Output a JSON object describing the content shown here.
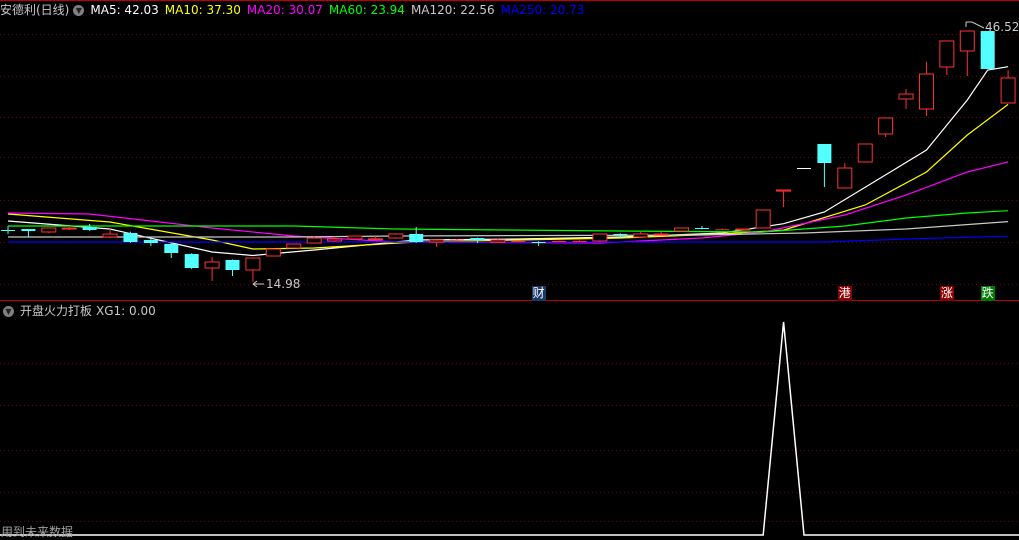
{
  "header": {
    "stock_title": "安德利(日线)",
    "ma": [
      {
        "label": "MA5: 42.03",
        "color": "#ffffff"
      },
      {
        "label": "MA10: 37.30",
        "color": "#ffff00"
      },
      {
        "label": "MA20: 30.07",
        "color": "#ff00ff"
      },
      {
        "label": "MA60: 23.94",
        "color": "#00ff00"
      },
      {
        "label": "MA120: 22.56",
        "color": "#c8c8c8"
      },
      {
        "label": "MA250: 20.73",
        "color": "#0000ff"
      }
    ]
  },
  "indicator": {
    "title": "开盘火力打板",
    "value_label": "XG1: 0.00"
  },
  "footer_note": "用到未来数据",
  "annotations": {
    "high": "46.52",
    "low": "14.98"
  },
  "markers": [
    {
      "text": "财",
      "index": 26,
      "bg": "#1a3a6a"
    },
    {
      "text": "港",
      "index": 41,
      "bg": "#8b0000"
    },
    {
      "text": "涨",
      "index": 46,
      "bg": "#8b0000"
    },
    {
      "text": "跌",
      "index": 48,
      "bg": "#007a00"
    }
  ],
  "colors": {
    "up": "#ff3232",
    "down": "#54ffff",
    "flat": "#ffffff",
    "grid": "#7a0000",
    "divider": "#c00000"
  },
  "chart_data": {
    "type": "candlestick",
    "price_range": [
      14.98,
      46.52
    ],
    "ohlc": [
      [
        21.51,
        22.01,
        21.01,
        21.48
      ],
      [
        21.63,
        21.63,
        20.63,
        21.38
      ],
      [
        21.26,
        21.76,
        21.13,
        21.76
      ],
      [
        21.63,
        21.89,
        21.5,
        21.76
      ],
      [
        21.89,
        22.26,
        21.4,
        21.51
      ],
      [
        20.63,
        21.76,
        20.5,
        21.0
      ],
      [
        21.13,
        21.3,
        19.9,
        20.0
      ],
      [
        20.25,
        20.6,
        19.5,
        19.87
      ],
      [
        19.75,
        19.9,
        17.99,
        18.62
      ],
      [
        18.49,
        18.6,
        16.6,
        16.73
      ],
      [
        16.73,
        18.11,
        15.1,
        17.49
      ],
      [
        17.74,
        17.8,
        15.73,
        16.48
      ],
      [
        16.48,
        17.99,
        14.98,
        17.99
      ],
      [
        18.24,
        19.2,
        18.2,
        19.12
      ],
      [
        19.25,
        19.8,
        19.2,
        19.75
      ],
      [
        19.87,
        20.75,
        19.8,
        20.5
      ],
      [
        20.13,
        20.7,
        20.0,
        20.38
      ],
      [
        20.38,
        20.8,
        20.3,
        20.75
      ],
      [
        20.38,
        20.75,
        20.3,
        20.4
      ],
      [
        20.5,
        21.1,
        20.4,
        21.01
      ],
      [
        21.01,
        21.89,
        19.9,
        20.0
      ],
      [
        20.0,
        20.3,
        19.37,
        20.25
      ],
      [
        20.3,
        20.4,
        20.2,
        20.3
      ],
      [
        20.5,
        20.55,
        19.87,
        20.25
      ],
      [
        20.0,
        20.4,
        19.9,
        20.25
      ],
      [
        20.13,
        20.2,
        20.05,
        20.13
      ],
      [
        20.0,
        20.1,
        19.5,
        19.87
      ],
      [
        20.13,
        20.2,
        20.05,
        20.13
      ],
      [
        20.13,
        20.2,
        20.05,
        20.13
      ],
      [
        20.13,
        21.05,
        20.0,
        21.01
      ],
      [
        21.01,
        21.1,
        20.5,
        20.88
      ],
      [
        20.63,
        21.26,
        20.5,
        21.01
      ],
      [
        20.88,
        21.3,
        20.8,
        21.0
      ],
      [
        21.38,
        21.8,
        21.3,
        21.76
      ],
      [
        21.76,
        22.01,
        21.6,
        21.7
      ],
      [
        21.6,
        21.7,
        21.5,
        21.6
      ],
      [
        21.5,
        21.7,
        21.4,
        21.63
      ],
      [
        21.76,
        24.02,
        21.7,
        24.02
      ],
      [
        26.4,
        26.54,
        24.4,
        26.54
      ],
      [
        29.3,
        29.3,
        29.3,
        29.3
      ],
      [
        32.32,
        32.32,
        26.91,
        29.93
      ],
      [
        26.79,
        29.93,
        26.79,
        29.3
      ],
      [
        30.06,
        32.32,
        30.0,
        32.32
      ],
      [
        33.58,
        35.59,
        33.2,
        35.59
      ],
      [
        37.98,
        39.23,
        36.72,
        38.6
      ],
      [
        36.72,
        42.63,
        35.84,
        41.12
      ],
      [
        42.0,
        45.27,
        40.99,
        45.27
      ],
      [
        44.01,
        46.52,
        40.87,
        46.52
      ],
      [
        46.52,
        46.52,
        41.75,
        41.75
      ],
      [
        37.47,
        41.62,
        37.47,
        40.62
      ]
    ],
    "ma_series": [
      {
        "name": "MA5",
        "color": "#ffffff",
        "points": [
          [
            0,
            22.64
          ],
          [
            5,
            21.63
          ],
          [
            10,
            18.74
          ],
          [
            12,
            18.3
          ],
          [
            15,
            18.99
          ],
          [
            20,
            20.25
          ],
          [
            25,
            20.38
          ],
          [
            30,
            20.63
          ],
          [
            35,
            21.13
          ],
          [
            38,
            22.3
          ],
          [
            40,
            23.77
          ],
          [
            45,
            31.57
          ],
          [
            47,
            37.85
          ],
          [
            48,
            41.62
          ],
          [
            49,
            42.03
          ]
        ]
      },
      {
        "name": "MA10",
        "color": "#ffff00",
        "points": [
          [
            0,
            23.52
          ],
          [
            5,
            22.51
          ],
          [
            10,
            20.25
          ],
          [
            12,
            19.12
          ],
          [
            15,
            19.25
          ],
          [
            20,
            20.0
          ],
          [
            25,
            20.25
          ],
          [
            30,
            20.5
          ],
          [
            35,
            21.0
          ],
          [
            38,
            21.5
          ],
          [
            42,
            24.65
          ],
          [
            45,
            28.8
          ],
          [
            47,
            33.45
          ],
          [
            49,
            37.3
          ]
        ]
      },
      {
        "name": "MA20",
        "color": "#ff00ff",
        "points": [
          [
            0,
            23.65
          ],
          [
            4,
            23.52
          ],
          [
            10,
            21.76
          ],
          [
            14,
            20.75
          ],
          [
            19,
            20.0
          ],
          [
            29,
            19.87
          ],
          [
            34,
            20.5
          ],
          [
            37,
            21.26
          ],
          [
            41,
            23.4
          ],
          [
            44,
            25.9
          ],
          [
            47,
            28.8
          ],
          [
            49,
            30.07
          ]
        ]
      },
      {
        "name": "MA60",
        "color": "#00ff00",
        "points": [
          [
            0,
            22.01
          ],
          [
            14,
            22.01
          ],
          [
            19,
            21.63
          ],
          [
            30,
            21.38
          ],
          [
            37,
            21.26
          ],
          [
            41,
            22.01
          ],
          [
            44,
            23.02
          ],
          [
            47,
            23.65
          ],
          [
            49,
            23.94
          ]
        ]
      },
      {
        "name": "MA120",
        "color": "#c8c8c8",
        "points": [
          [
            0,
            20.63
          ],
          [
            14,
            20.63
          ],
          [
            19,
            20.75
          ],
          [
            34,
            20.88
          ],
          [
            39,
            21.13
          ],
          [
            44,
            21.63
          ],
          [
            49,
            22.56
          ]
        ]
      },
      {
        "name": "MA250",
        "color": "#0000ff",
        "points": [
          [
            0,
            20.0
          ],
          [
            40,
            20.0
          ],
          [
            44,
            20.38
          ],
          [
            49,
            20.73
          ]
        ]
      }
    ],
    "indicator_series": {
      "name": "XG1",
      "range": [
        0,
        1
      ],
      "nonzero": [
        [
          38,
          1
        ]
      ]
    }
  }
}
